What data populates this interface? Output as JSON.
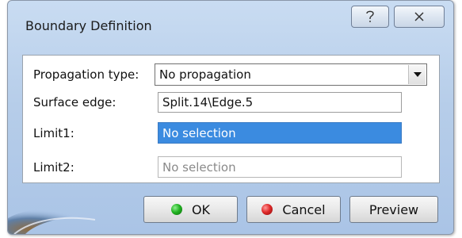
{
  "window": {
    "title": "Boundary Definition",
    "help_icon": "question-mark-icon",
    "close_icon": "close-x-icon"
  },
  "form": {
    "propagation_label": "Propagation type:",
    "propagation_value": "No propagation",
    "surface_edge_label": "Surface edge:",
    "surface_edge_value": "Split.14\\Edge.5",
    "limit1_label": "Limit1:",
    "limit1_value": "No selection",
    "limit2_label": "Limit2:",
    "limit2_value": "No selection"
  },
  "buttons": {
    "ok_label": "OK",
    "cancel_label": "Cancel",
    "preview_label": "Preview"
  },
  "colors": {
    "selection_blue": "#3b8be0",
    "ok_dot": "#22b322",
    "cancel_dot": "#e02a2a"
  }
}
